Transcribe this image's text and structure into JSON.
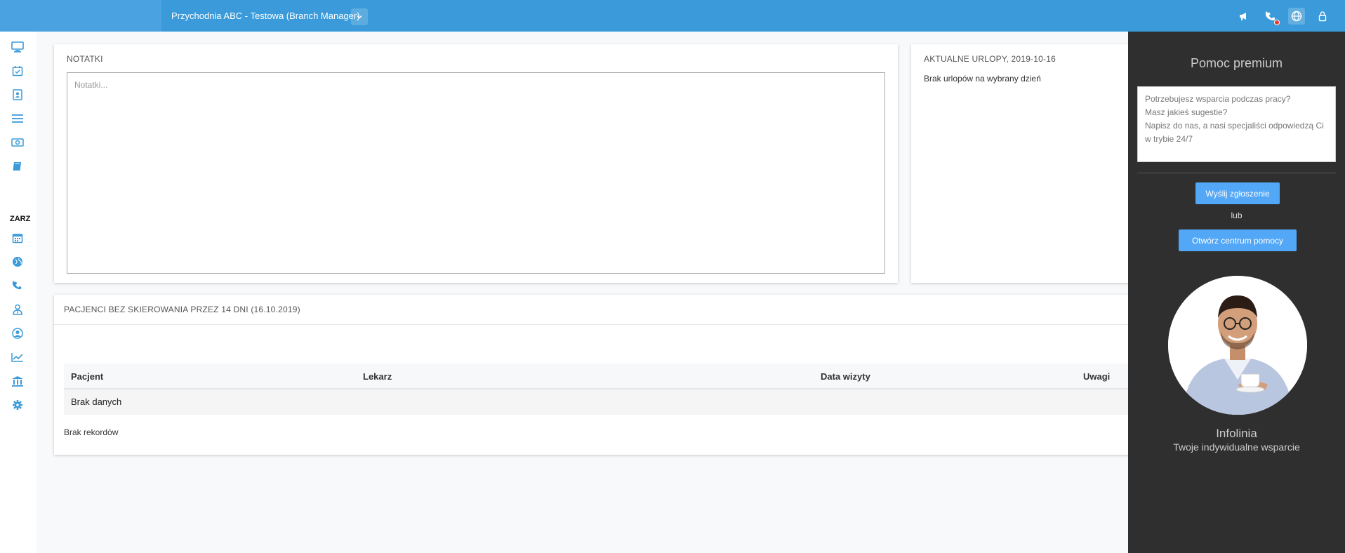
{
  "header": {
    "clinic_label": "Przychodnia ABC - Testowa (Branch Manager)",
    "icons": [
      "dropdown-chevron-icon",
      "megaphone-icon",
      "phone-icon",
      "globe-icon",
      "lock-icon"
    ],
    "accent": "#3a9ada"
  },
  "sidebar": {
    "section_label": "ZARZ",
    "items": [
      "monitor-icon",
      "calendar-check-icon",
      "contacts-icon",
      "menu-lines-icon",
      "money-icon",
      "book-icon",
      "calendar-icon",
      "globe-icon",
      "phone-icon",
      "user-tie-icon",
      "user-circle-icon",
      "chart-line-icon",
      "bank-icon",
      "gear-icon"
    ]
  },
  "notes": {
    "title": "NOTATKI",
    "placeholder": "Notatki..."
  },
  "leave": {
    "title": "AKTUALNE URLOPY, 2019-10-16",
    "message": "Brak urlopów na wybrany dzień"
  },
  "patients": {
    "title": "PACJENCI BEZ SKIEROWANIA PRZEZ 14 DNI (16.10.2019)",
    "columns": [
      "Pacjent",
      "Lekarz",
      "Data wizyty",
      "Uwagi"
    ],
    "empty_row": "Brak danych",
    "footer": "Brak rekordów"
  },
  "premium": {
    "title": "Pomoc premium",
    "placeholder": "Potrzebujesz wsparcia podczas pracy?\nMasz jakieś sugestie?\nNapisz do nas, a nasi specjaliści odpowiedzą Ci w trybie 24/7",
    "send_label": "Wyślij zgłoszenie",
    "or_label": "lub",
    "help_label": "Otwórz centrum pomocy",
    "name": "Infolinia",
    "subtitle": "Twoje indywidualne wsparcie",
    "button_color": "#52a7f7"
  }
}
